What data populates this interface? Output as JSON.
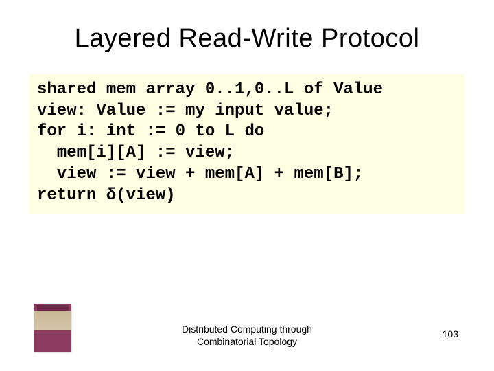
{
  "title": "Layered Read-Write Protocol",
  "code": {
    "l1": "shared mem array 0..1,0..L of Value",
    "l2": "view: Value := my input value;",
    "l3": "for i: int := 0 to L do",
    "l4": "  mem[i][A] := view;",
    "l5": "  view := view + mem[A] + mem[B];",
    "l6": "return δ(view)"
  },
  "footer": {
    "line1": "Distributed Computing through",
    "line2": "Combinatorial Topology"
  },
  "page_number": "103"
}
